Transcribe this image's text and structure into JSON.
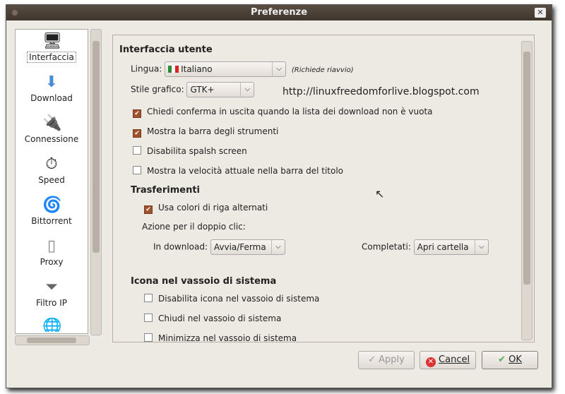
{
  "window": {
    "title": "Preferenze"
  },
  "sidebar": {
    "items": [
      {
        "label": "Interfaccia",
        "icon": "interface-icon",
        "glyph": "🖥"
      },
      {
        "label": "Download",
        "icon": "download-icon",
        "glyph": "⬇"
      },
      {
        "label": "Connessione",
        "icon": "connection-icon",
        "glyph": "🔌"
      },
      {
        "label": "Speed",
        "icon": "speed-icon",
        "glyph": "⏱"
      },
      {
        "label": "Bittorrent",
        "icon": "bittorrent-icon",
        "glyph": "🌀"
      },
      {
        "label": "Proxy",
        "icon": "proxy-icon",
        "glyph": "▯"
      },
      {
        "label": "Filtro IP",
        "icon": "filter-icon",
        "glyph": "⏷"
      },
      {
        "label": "",
        "icon": "web-icon",
        "glyph": "🌐"
      }
    ]
  },
  "ui": {
    "section_title": "Interfaccia utente",
    "lingua_label": "Lingua:",
    "lingua_value": "Italiano",
    "lingua_note": "(Richiede riavvio)",
    "stile_label": "Stile grafico:",
    "stile_value": "GTK+",
    "watermark": "http://linuxfreedomforlive.blogspot.com",
    "checks": [
      {
        "label": "Chiedi conferma in uscita quando la lista dei download non è vuota",
        "checked": true
      },
      {
        "label": "Mostra la barra degli strumenti",
        "checked": true
      },
      {
        "label": "Disabilita spalsh screen",
        "checked": false
      },
      {
        "label": "Mostra la velocità attuale nella barra del titolo",
        "checked": false
      }
    ]
  },
  "transfers": {
    "title": "Trasferimenti",
    "alt_colors": {
      "label": "Usa colori di riga alternati",
      "checked": true
    },
    "double_click_label": "Azione per il doppio clic:",
    "in_download_label": "In download:",
    "in_download_value": "Avvia/Ferma",
    "completed_label": "Completati:",
    "completed_value": "Apri cartella"
  },
  "tray": {
    "title": "Icona nel vassoio di sistema",
    "checks": [
      {
        "label": "Disabilita icona nel vassoio di sistema",
        "checked": false
      },
      {
        "label": "Chiudi nel vassoio di sistema",
        "checked": false
      },
      {
        "label": "Minimizza nel vassoio di sistema",
        "checked": false
      }
    ]
  },
  "buttons": {
    "apply": "Apply",
    "cancel": "Cancel",
    "ok": "OK"
  },
  "colors": {
    "titlebar": "#4a4036",
    "checkbox": "#a0522d",
    "window_bg": "#ede9e3"
  }
}
